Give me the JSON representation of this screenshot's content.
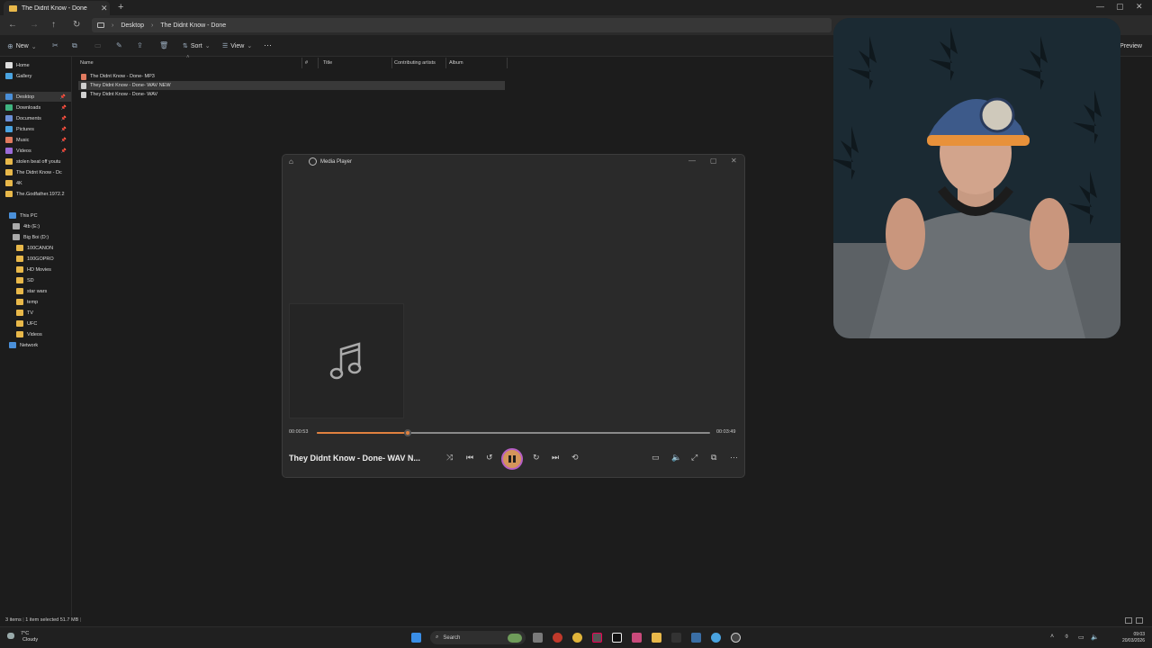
{
  "explorer": {
    "tab_title": "The Didnt Know - Done",
    "breadcrumb": [
      "Desktop",
      "The Didnt Know - Done"
    ],
    "toolbar": {
      "new_label": "New",
      "sort_label": "Sort",
      "view_label": "View",
      "more_label": "···",
      "preview_label": "Preview"
    },
    "sidebar": {
      "quick": [
        {
          "label": "Home",
          "color": "#e0e0e0"
        },
        {
          "label": "Gallery",
          "color": "#4aa3e0"
        }
      ],
      "pinned": [
        {
          "label": "Desktop",
          "color": "#4a8fd8",
          "pinned": true
        },
        {
          "label": "Downloads",
          "color": "#3fb37f",
          "pinned": true
        },
        {
          "label": "Documents",
          "color": "#6b8fd6",
          "pinned": true
        },
        {
          "label": "Pictures",
          "color": "#4aa3e0",
          "pinned": true
        },
        {
          "label": "Music",
          "color": "#e07a5f",
          "pinned": true
        },
        {
          "label": "Videos",
          "color": "#9b6bd8",
          "pinned": true
        },
        {
          "label": "stolen beat off youtu",
          "color": "#e8b84a",
          "pinned": false
        },
        {
          "label": "The Didnt Know - Dc",
          "color": "#e8b84a",
          "pinned": false
        },
        {
          "label": "4K",
          "color": "#e8b84a",
          "pinned": false
        },
        {
          "label": "The.Godfather.1972.2",
          "color": "#e8b84a",
          "pinned": false
        }
      ],
      "drives": [
        {
          "label": "This PC",
          "color": "#4a8fd8"
        },
        {
          "label": "4tb (E:)",
          "color": "#aaaaaa"
        },
        {
          "label": "Big Boi (D:)",
          "color": "#aaaaaa"
        },
        {
          "label": "100CANON",
          "color": "#e8b84a"
        },
        {
          "label": "100GOPRO",
          "color": "#e8b84a"
        },
        {
          "label": "HD Movies",
          "color": "#e8b84a"
        },
        {
          "label": "SD",
          "color": "#e8b84a"
        },
        {
          "label": "star wars",
          "color": "#e8b84a"
        },
        {
          "label": "temp",
          "color": "#e8b84a"
        },
        {
          "label": "TV",
          "color": "#e8b84a"
        },
        {
          "label": "UFC",
          "color": "#e8b84a"
        },
        {
          "label": "Videos",
          "color": "#e8b84a"
        },
        {
          "label": "Network",
          "color": "#4a8fd8"
        }
      ]
    },
    "columns": [
      "Name",
      "#",
      "Title",
      "Contributing artists",
      "Album"
    ],
    "files": [
      {
        "name": "The Didnt Know - Done- MP3",
        "selected": false
      },
      {
        "name": "They Didnt Know - Done- WAV NEW",
        "selected": true
      },
      {
        "name": "They Didnt Know - Done- WAV",
        "selected": false
      }
    ],
    "status": {
      "items": "3 items",
      "selection": "1 item selected  51.7 MB"
    }
  },
  "media_player": {
    "app_title": "Media Player",
    "elapsed": "00:00:53",
    "duration": "00:03:49",
    "progress": 0.231,
    "track_title": "They Didnt Know - Done- WAV N...",
    "accent": "#e0813f"
  },
  "taskbar": {
    "weather_temp": "7°C",
    "weather_desc": "Cloudy",
    "search_label": "Search",
    "time": "09:03",
    "date": "20/03/2026"
  }
}
